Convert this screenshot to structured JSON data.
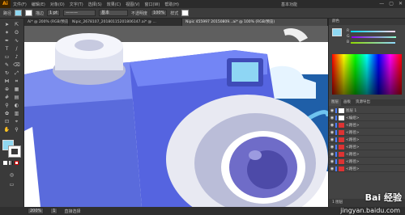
{
  "app": {
    "logo": "Ai"
  },
  "menubar": {
    "items": [
      "文件(F)",
      "编辑(E)",
      "对象(O)",
      "文字(T)",
      "选择(S)",
      "效果(C)",
      "视图(V)",
      "窗口(W)",
      "帮助(H)"
    ],
    "workspace": "基本功能"
  },
  "control_bar": {
    "stroke_label": "描边",
    "stroke_value": "1 pt",
    "brush": "基本",
    "opacity_label": "不透明度",
    "opacity": "100%",
    "style_label": "样式"
  },
  "tabs": [
    {
      "label": "Ai* @ 200% (RGB/预览)",
      "active": false
    },
    {
      "label": "Nipic_2678107_20180115201806147.ai* @ ...",
      "active": false
    },
    {
      "label": "Nipic 455997 20150809...ai* @ 100% (RGB/预览)",
      "active": true
    }
  ],
  "status": {
    "zoom": "200%",
    "page": "1",
    "tool": "直接选择"
  },
  "color_panel": {
    "labels": [
      "R",
      "G",
      "B"
    ],
    "values": [
      "",
      "",
      ""
    ]
  },
  "layers_panel": {
    "tabs": [
      "图层",
      "画板",
      "资源导出"
    ],
    "rows": [
      "图层 1",
      "<编组>",
      "<路径>",
      "<路径>",
      "<路径>",
      "<路径>",
      "<路径>",
      "<路径>",
      "<路径>"
    ],
    "footer": "1 图层"
  },
  "watermark": {
    "line1": "Bai 经验",
    "line2": "jingyan.baidu.com"
  }
}
